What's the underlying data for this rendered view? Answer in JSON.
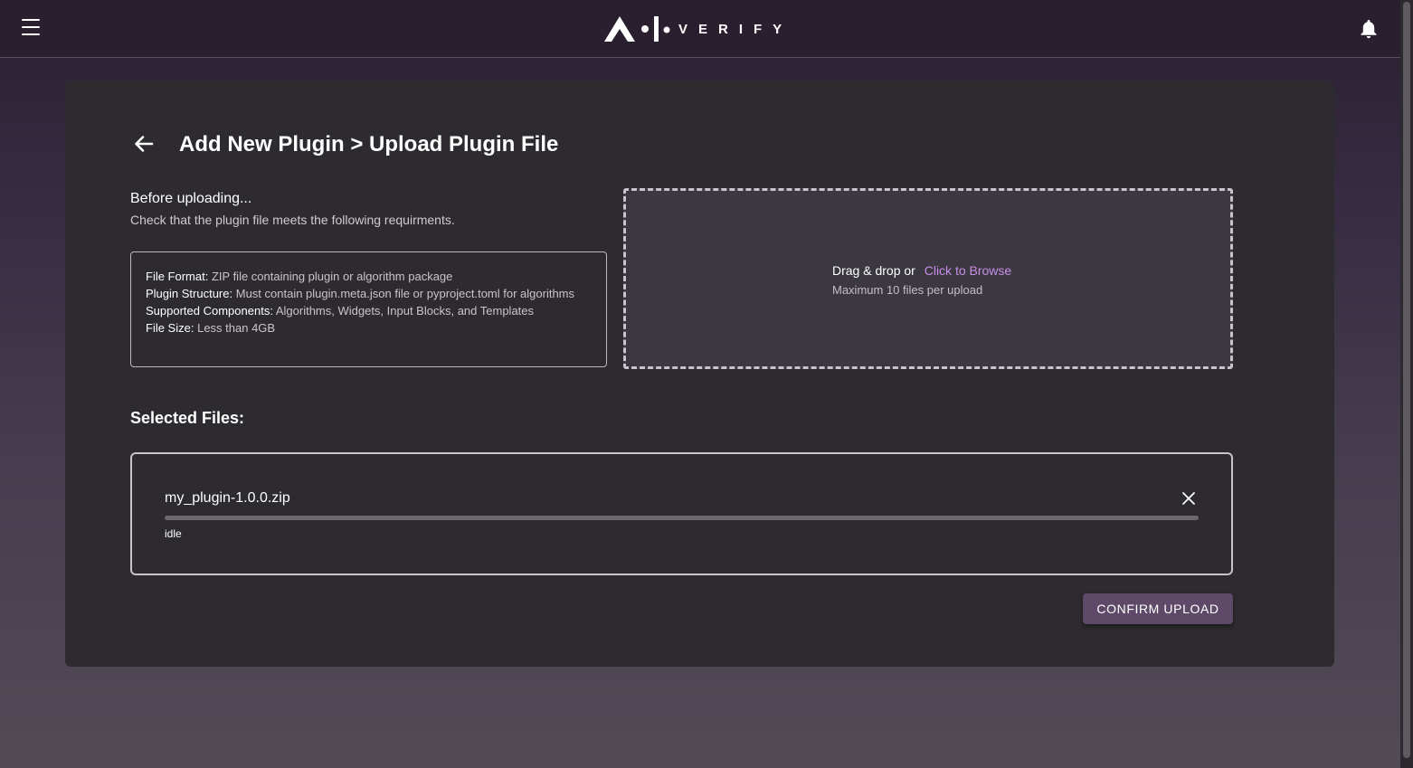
{
  "topbar": {
    "menu_icon": "hamburger-menu-icon",
    "logo_text": "VERIFY",
    "notification_icon": "bell-icon"
  },
  "page": {
    "back_icon": "arrow-left-icon",
    "title": "Add New Plugin > Upload Plugin File"
  },
  "requirements": {
    "heading": "Before uploading...",
    "subheading": "Check that the plugin file meets the following requirments.",
    "items": [
      {
        "label": "File Format:",
        "value": "ZIP file containing plugin or algorithm package"
      },
      {
        "label": "Plugin Structure:",
        "value": "Must contain plugin.meta.json file or pyproject.toml for algorithms"
      },
      {
        "label": "Supported Components:",
        "value": "Algorithms, Widgets, Input Blocks, and Templates"
      },
      {
        "label": "File Size:",
        "value": "Less than 4GB"
      }
    ]
  },
  "dropzone": {
    "text": "Drag & drop or",
    "browse_link": "Click to Browse",
    "limit_text": "Maximum 10 files per upload"
  },
  "selected_files": {
    "heading": "Selected Files:",
    "files": [
      {
        "name": "my_plugin-1.0.0.zip",
        "status": "idle",
        "progress": 0,
        "remove_icon": "close-icon"
      }
    ]
  },
  "actions": {
    "confirm_label": "CONFIRM UPLOAD"
  },
  "colors": {
    "accent": "#c88ee8",
    "button": "#5e4a68",
    "card": "#2d2b30",
    "topbar": "#2a1f2f"
  }
}
